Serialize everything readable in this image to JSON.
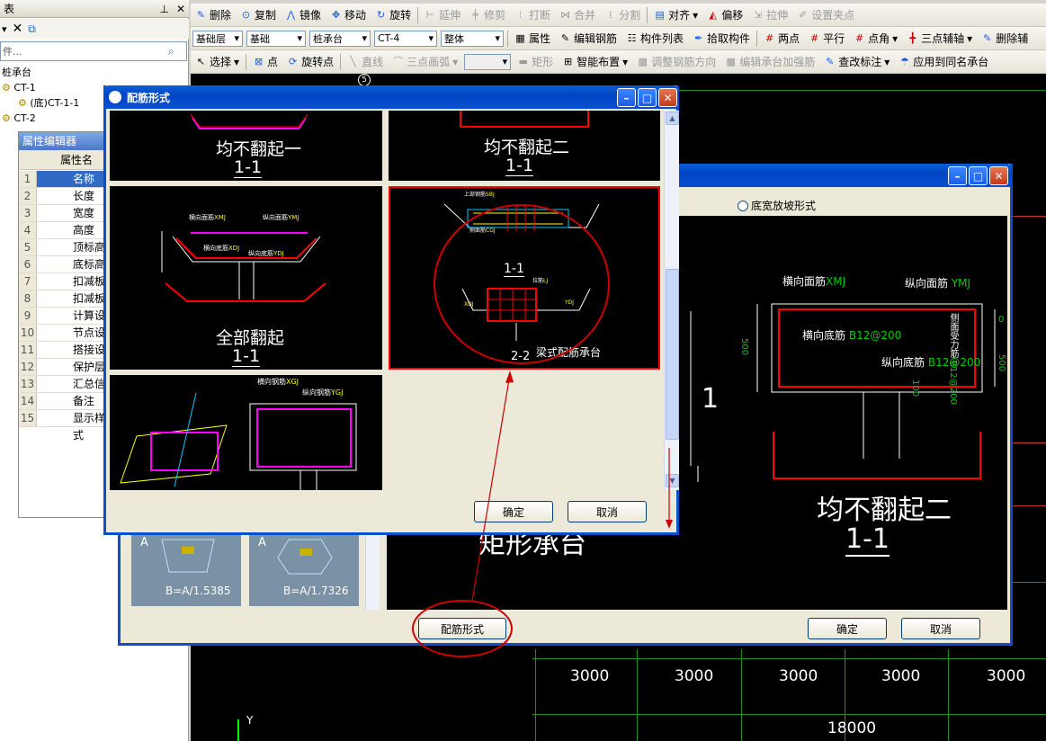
{
  "left_panel": {
    "title": "表",
    "pin": "ᵖ",
    "search_placeholder": "件...",
    "tree": [
      "桩承台",
      "CT-1",
      "(底)CT-1-1",
      "CT-2"
    ]
  },
  "toolbar1": [
    "删除",
    "复制",
    "镜像",
    "移动",
    "旋转",
    "延伸",
    "修剪",
    "打断",
    "合并",
    "分割",
    "对齐",
    "偏移",
    "拉伸",
    "设置夹点"
  ],
  "toolbar2": {
    "selects": [
      "基础层",
      "基础",
      "桩承台",
      "CT-4",
      "整体"
    ],
    "items": [
      "属性",
      "编辑钢筋",
      "构件列表",
      "拾取构件",
      "两点",
      "平行",
      "点角",
      "三点辅轴",
      "删除辅"
    ]
  },
  "toolbar3": [
    "选择",
    "点",
    "旋转点",
    "直线",
    "三点画弧",
    "矩形",
    "智能布置",
    "调整钢筋方向",
    "编辑承台加强筋",
    "查改标注",
    "应用到同名承台"
  ],
  "property_editor": {
    "title": "属性编辑器",
    "header": "属性名",
    "rows": [
      {
        "n": "1",
        "label": "名称"
      },
      {
        "n": "2",
        "label": "长度(mm)"
      },
      {
        "n": "3",
        "label": "宽度(mm)"
      },
      {
        "n": "4",
        "label": "高度(mm)"
      },
      {
        "n": "5",
        "label": "顶标高(m"
      },
      {
        "n": "6",
        "label": "底标高(m"
      },
      {
        "n": "7",
        "label": "扣减板/存"
      },
      {
        "n": "8",
        "label": "扣减板/存"
      },
      {
        "n": "9",
        "label": "计算设置"
      },
      {
        "n": "10",
        "label": "节点设置"
      },
      {
        "n": "11",
        "label": "搭接设置"
      },
      {
        "n": "12",
        "label": "保护层厚"
      },
      {
        "n": "13",
        "label": "汇总信息"
      },
      {
        "n": "14",
        "label": "备注"
      },
      {
        "n": "15",
        "label": "显示样式"
      }
    ]
  },
  "cad": {
    "dims": [
      "3000",
      "3000",
      "3000",
      "3000",
      "3000"
    ],
    "total": "18000",
    "axis_y": "Y",
    "axis_mark": "5"
  },
  "back_dialog": {
    "radio_label": "底宽放坡形式",
    "labels": {
      "top_h": "横向面筋",
      "top_h_code": "XMJ",
      "top_v": "纵向面筋",
      "top_v_code": "YMJ",
      "bot_h": "横向底筋",
      "bot_h_val": "B12@200",
      "bot_v": "纵向底筋",
      "bot_v_val": "B12@200",
      "side": "侧面受力筋",
      "side_val": "B12@200",
      "d500a": "500",
      "d0": "0",
      "d500b": "500",
      "d100": "100"
    },
    "caption": "均不翻起二",
    "section": "1-1",
    "left_caption": "矩形承台",
    "thumb1": "B=A/1.5385",
    "thumb2": "B=A/1.7326",
    "thumb_a": "A",
    "big_one": "1",
    "btn_rebar": "配筋形式",
    "btn_ok": "确定",
    "btn_cancel": "取消"
  },
  "front_dialog": {
    "title": "配筋形式",
    "cells": [
      {
        "caption": "均不翻起一",
        "section": "1-1"
      },
      {
        "caption": "均不翻起二",
        "section": "1-1"
      },
      {
        "caption": "全部翻起",
        "section": "1-1"
      },
      {
        "caption": "梁式配筋承台",
        "section": "1-1",
        "section2": "2-2"
      },
      {
        "caption": "",
        "section": ""
      }
    ],
    "small": {
      "h_face": "横向面筋",
      "h_face_c": "XMJ",
      "v_face": "纵向面筋",
      "v_face_c": "YMJ",
      "h_bot": "横向底筋",
      "h_bot_c": "XDJ",
      "v_bot": "纵向底筋",
      "v_bot_c": "YDJ",
      "side": "侧面筋",
      "side_c": "CGJ",
      "top_bar": "上部钢筋",
      "top_bar_c": "SBJ",
      "bar_lj": "拉筋",
      "bar_lj_c": "LJ",
      "xdj": "XDJ",
      "ydj": "YDJ",
      "h_g": "横向钢筋",
      "h_g_c": "XGJ",
      "v_g": "纵向钢筋",
      "v_g_c": "YGJ"
    },
    "ok": "确定",
    "cancel": "取消"
  }
}
